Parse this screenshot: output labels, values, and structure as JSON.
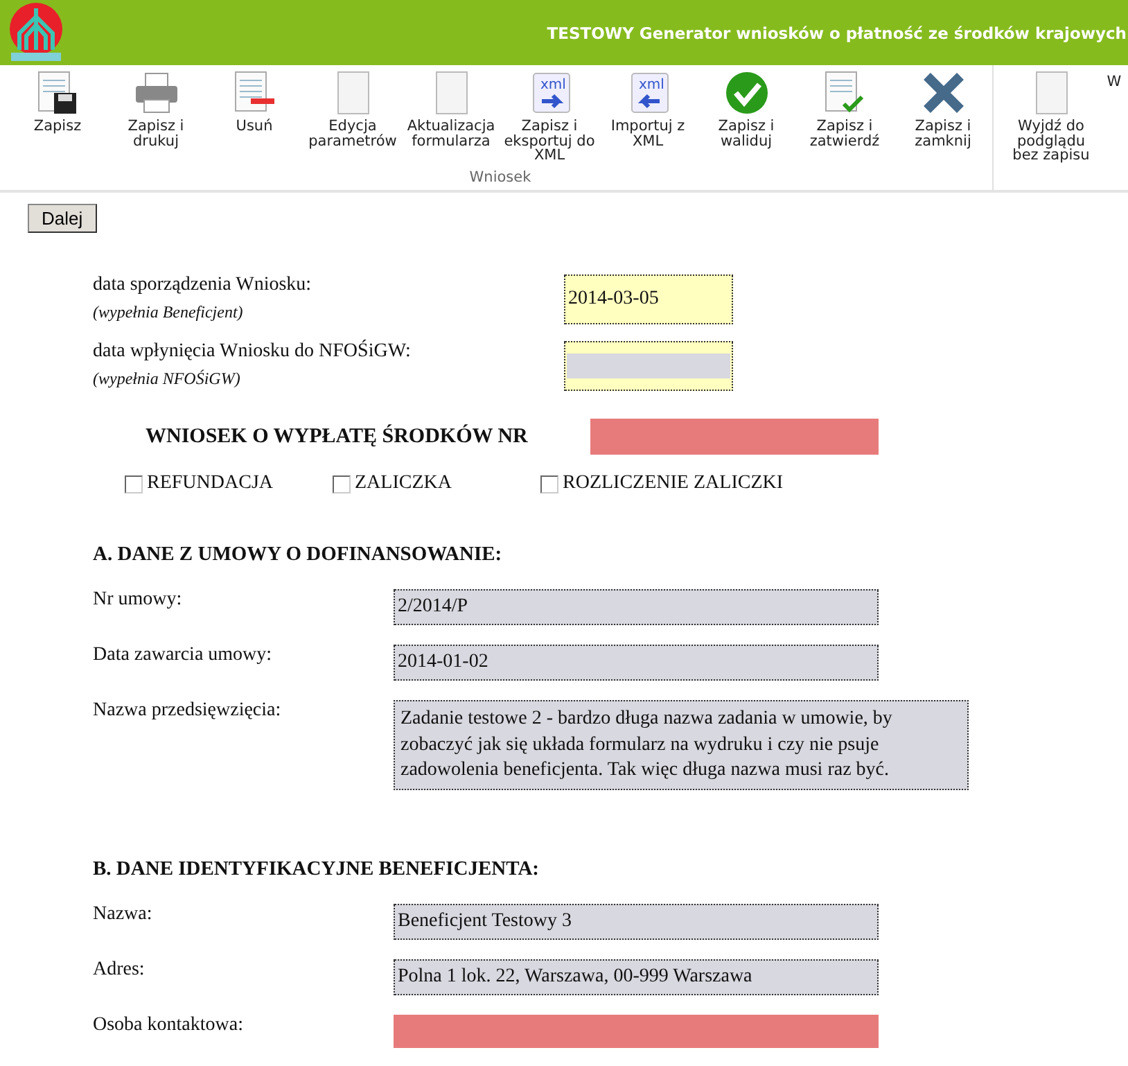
{
  "header": {
    "title": "TESTOWY Generator wniosków o płatność ze środków krajowych"
  },
  "toolbar": {
    "groups": [
      {
        "label": "Wniosek",
        "tools": [
          {
            "label": "Zapisz",
            "kind": "save"
          },
          {
            "label": "Zapisz i drukuj",
            "kind": "print"
          },
          {
            "label": "Usuń",
            "kind": "delete"
          },
          {
            "label": "Edycja parametrów",
            "kind": "plain"
          },
          {
            "label": "Aktualizacja formularza",
            "kind": "plain"
          },
          {
            "label": "Zapisz i eksportuj do XML",
            "kind": "export",
            "badge": "xml"
          },
          {
            "label": "Importuj z XML",
            "kind": "import",
            "badge": "xml"
          },
          {
            "label": "Zapisz i waliduj",
            "kind": "validate"
          },
          {
            "label": "Zapisz i zatwierdź",
            "kind": "approve"
          },
          {
            "label": "Zapisz i zamknij",
            "kind": "close"
          }
        ]
      },
      {
        "tools": [
          {
            "label": "Wyjdź do podglądu bez zapisu",
            "kind": "plain"
          },
          {
            "label": "W",
            "kind": "cut"
          }
        ]
      }
    ]
  },
  "next_button": "Dalej",
  "dates": [
    {
      "label": "data sporządzenia Wniosku:",
      "hint": "(wypełnia Beneficjent)",
      "kind": "editable",
      "value": "2014-03-05"
    },
    {
      "label": "data wpłynięcia Wniosku do NFOŚiGW:",
      "hint": "(wypełnia NFOŚiGW)",
      "kind": "pending"
    }
  ],
  "request": {
    "title": "WNIOSEK O WYPŁATĘ ŚRODKÓW NR",
    "kind": "required"
  },
  "types": [
    {
      "label": "REFUNDACJA",
      "checked": false
    },
    {
      "label": "ZALICZKA",
      "checked": false
    },
    {
      "label": "ROZLICZENIE ZALICZKI",
      "checked": false
    }
  ],
  "sections": [
    {
      "title": "A. DANE Z UMOWY O DOFINANSOWANIE:",
      "fields": [
        {
          "label": "Nr umowy:",
          "kind": "readonly",
          "value": "2/2014/P"
        },
        {
          "label": "Data zawarcia umowy:",
          "kind": "readonly",
          "value": "2014-01-02"
        },
        {
          "label": "Nazwa przedsięwzięcia:",
          "kind": "readonly-multiline",
          "value": "Zadanie testowe 2 - bardzo długa nazwa zadania w umowie, by zobaczyć jak się układa formularz na wydruku i czy nie psuje zadowolenia beneficjenta. Tak więc długa nazwa musi raz być."
        }
      ]
    },
    {
      "title": "B. DANE IDENTYFIKACYJNE BENEFICJENTA:",
      "fields": [
        {
          "label": "Nazwa:",
          "kind": "readonly",
          "value": "Beneficjent Testowy 3"
        },
        {
          "label": "Adres:",
          "kind": "readonly",
          "value": "Polna 1 lok. 22, Warszawa, 00-999 Warszawa"
        },
        {
          "label": "Osoba kontaktowa:",
          "kind": "required"
        }
      ]
    }
  ]
}
